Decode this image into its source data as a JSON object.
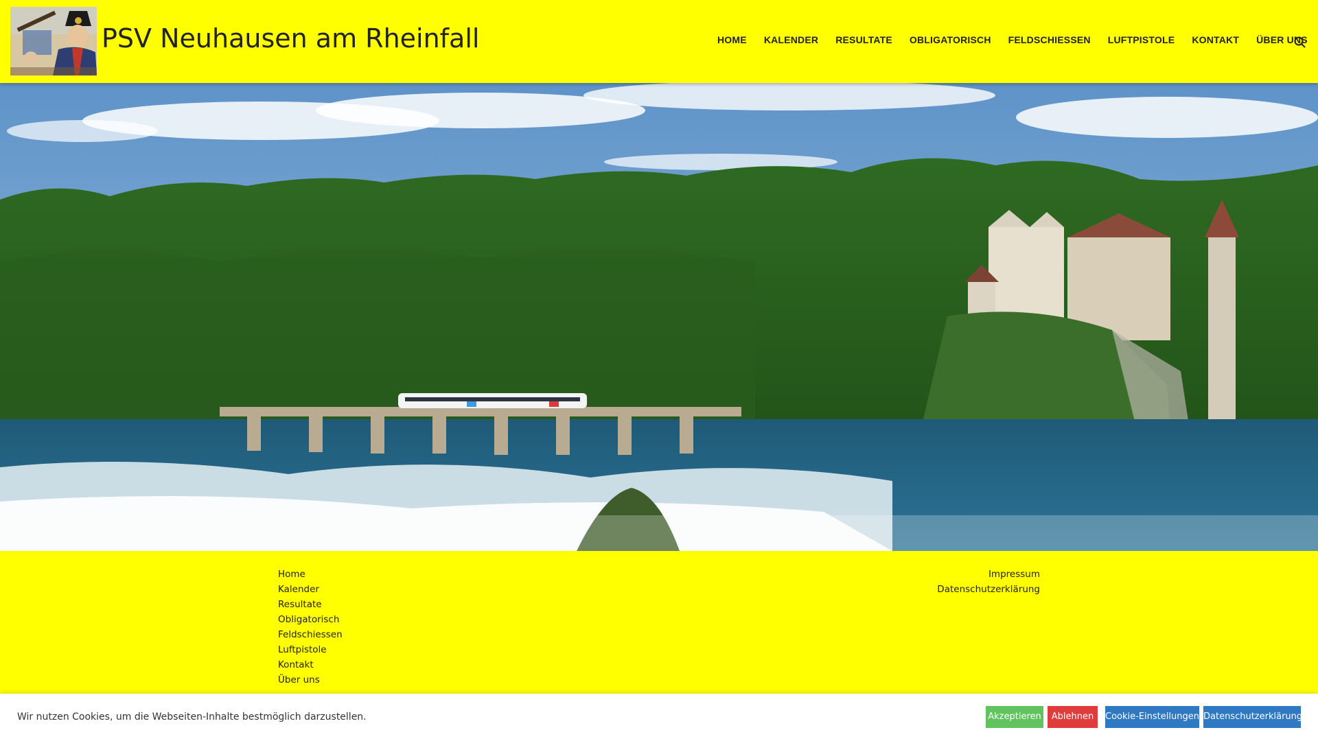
{
  "header": {
    "site_title": "PSV Neuhausen am Rheinfall",
    "nav": [
      "HOME",
      "KALENDER",
      "RESULTATE",
      "OBLIGATORISCH",
      "FELDSCHIESSEN",
      "LUFTPISTOLE",
      "KONTAKT",
      "ÜBER UNS"
    ],
    "search_icon": "search-icon"
  },
  "footer": {
    "menu": [
      "Home",
      "Kalender",
      "Resultate",
      "Obligatorisch",
      "Feldschiessen",
      "Luftpistole",
      "Kontakt",
      "Über uns"
    ],
    "legal": [
      "Impressum",
      "Datenschutzerklärung"
    ]
  },
  "cookie": {
    "text": "Wir nutzen Cookies, um die Webseiten-Inhalte bestmöglich darzustellen.",
    "accept": "Akzeptieren",
    "reject": "Ablehnen",
    "settings": "Cookie-Einstellungen",
    "privacy": "Datenschutzerklärung"
  },
  "colors": {
    "brand_yellow": "#ffff00",
    "accept_green": "#61c35e",
    "reject_red": "#e03c3c",
    "settings_blue": "#2f78c4",
    "privacy_blue": "#2f78c4"
  }
}
